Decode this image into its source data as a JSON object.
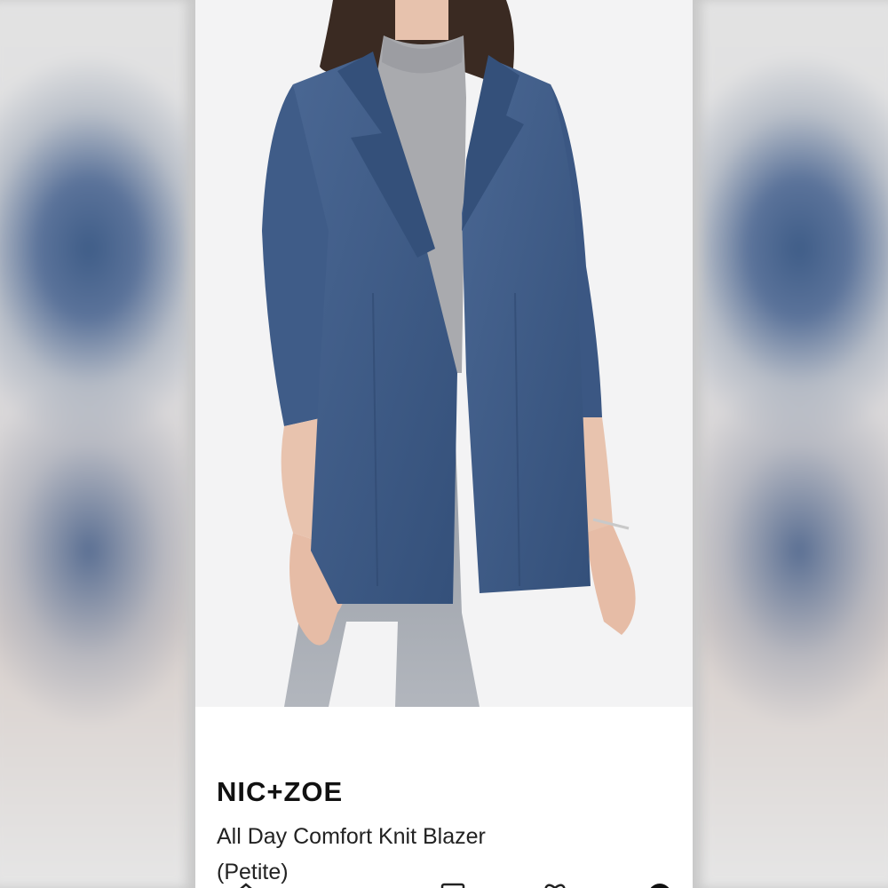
{
  "product": {
    "brand": "NIC+ZOE",
    "name": "All Day Comfort Knit Blazer (Petite)",
    "image_alt": "Woman wearing heathered navy open-front knit blazer over grey turtleneck and light grey jeans"
  },
  "colors": {
    "blazer": "#3d5a85",
    "sweater": "#a9aaae",
    "jeans": "#9ea3ab",
    "background": "#f3f3f4"
  },
  "tab_bar": {
    "items": [
      {
        "icon": "home-icon"
      },
      {
        "icon": "shop-icon"
      },
      {
        "icon": "heart-icon"
      },
      {
        "icon": "profile-icon"
      }
    ]
  }
}
